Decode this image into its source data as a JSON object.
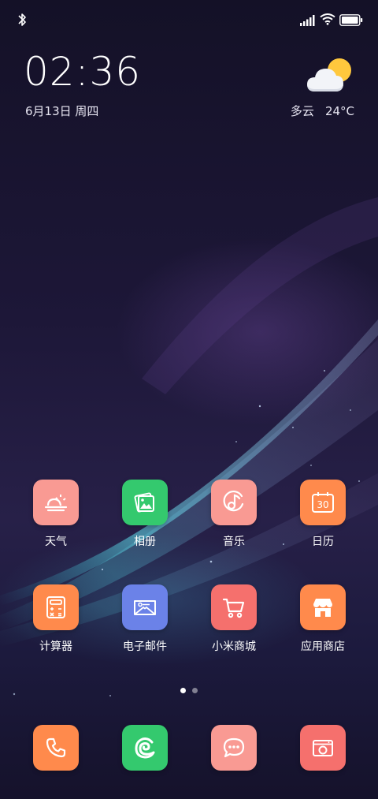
{
  "status_bar": {
    "bluetooth_icon": "bluetooth-icon",
    "signal_icon": "cell-signal-icon",
    "wifi_icon": "wifi-icon",
    "battery_icon": "battery-icon"
  },
  "clock": {
    "time": "02:36",
    "date": "6月13日 周四"
  },
  "weather": {
    "icon": "partly-cloudy-icon",
    "condition": "多云",
    "temperature": "24°C"
  },
  "apps": [
    {
      "label": "天气",
      "icon": "weather-icon",
      "color": "#f99a93"
    },
    {
      "label": "相册",
      "icon": "gallery-icon",
      "color": "#34c96e"
    },
    {
      "label": "音乐",
      "icon": "music-icon",
      "color": "#f99a93"
    },
    {
      "label": "日历",
      "icon": "calendar-icon",
      "color": "#ff8a4c"
    },
    {
      "label": "计算器",
      "icon": "calculator-icon",
      "color": "#ff8a4c"
    },
    {
      "label": "电子邮件",
      "icon": "email-icon",
      "color": "#6b82e8"
    },
    {
      "label": "小米商城",
      "icon": "shopping-cart-icon",
      "color": "#f5706d"
    },
    {
      "label": "应用商店",
      "icon": "app-store-icon",
      "color": "#ff8a4c"
    }
  ],
  "calendar_day": "30",
  "page_indicator": {
    "pages": 2,
    "current": 1
  },
  "dock": [
    {
      "icon": "phone-icon",
      "color": "#ff8a4c"
    },
    {
      "icon": "browser-icon",
      "color": "#34c96e"
    },
    {
      "icon": "messages-icon",
      "color": "#f99a93"
    },
    {
      "icon": "camera-icon",
      "color": "#f5706d"
    }
  ]
}
